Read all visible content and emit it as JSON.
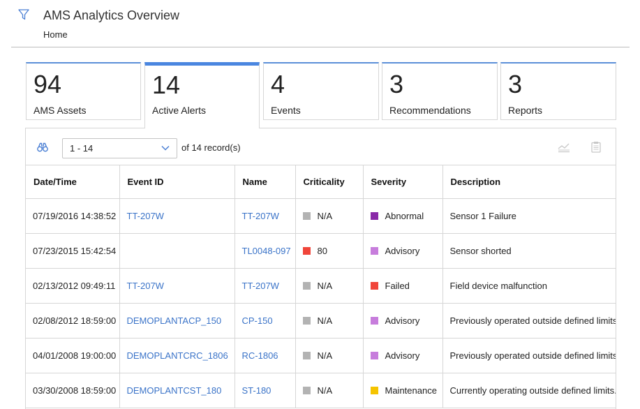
{
  "header": {
    "title": "AMS Analytics Overview",
    "breadcrumb": "Home"
  },
  "tiles": [
    {
      "value": "94",
      "label": "AMS Assets"
    },
    {
      "value": "14",
      "label": "Active Alerts"
    },
    {
      "value": "4",
      "label": "Events"
    },
    {
      "value": "3",
      "label": "Recommendations"
    },
    {
      "value": "3",
      "label": "Reports"
    }
  ],
  "active_tile": "Active Alerts",
  "toolbar": {
    "page_range": "1 - 14",
    "record_count_text": "of 14 record(s)"
  },
  "table": {
    "columns": [
      "Date/Time",
      "Event ID",
      "Name",
      "Criticality",
      "Severity",
      "Description"
    ],
    "rows": [
      {
        "datetime": "07/19/2016 14:38:52",
        "event_id": "TT-207W",
        "name": "TT-207W",
        "criticality": "N/A",
        "criticality_color": "#b3b3b3",
        "severity": "Abnormal",
        "severity_color": "#8a2aa8",
        "description": "Sensor 1 Failure"
      },
      {
        "datetime": "07/23/2015 15:42:54",
        "event_id": "",
        "name": "TL0048-097",
        "criticality": "80",
        "criticality_color": "#f0453a",
        "severity": "Advisory",
        "severity_color": "#c77ddc",
        "description": "Sensor shorted"
      },
      {
        "datetime": "02/13/2012 09:49:11",
        "event_id": "TT-207W",
        "name": "TT-207W",
        "criticality": "N/A",
        "criticality_color": "#b3b3b3",
        "severity": "Failed",
        "severity_color": "#f0453a",
        "description": "Field device malfunction"
      },
      {
        "datetime": "02/08/2012 18:59:00",
        "event_id": "DEMOPLANTACP_150",
        "name": "CP-150",
        "criticality": "N/A",
        "criticality_color": "#b3b3b3",
        "severity": "Advisory",
        "severity_color": "#c77ddc",
        "description": "Previously operated outside defined limits."
      },
      {
        "datetime": "04/01/2008 19:00:00",
        "event_id": "DEMOPLANTCRC_1806",
        "name": "RC-1806",
        "criticality": "N/A",
        "criticality_color": "#b3b3b3",
        "severity": "Advisory",
        "severity_color": "#c77ddc",
        "description": "Previously operated outside defined limits."
      },
      {
        "datetime": "03/30/2008 18:59:00",
        "event_id": "DEMOPLANTCST_180",
        "name": "ST-180",
        "criticality": "N/A",
        "criticality_color": "#b3b3b3",
        "severity": "Maintenance",
        "severity_color": "#f5c400",
        "description": "Currently operating outside defined limits."
      }
    ]
  }
}
